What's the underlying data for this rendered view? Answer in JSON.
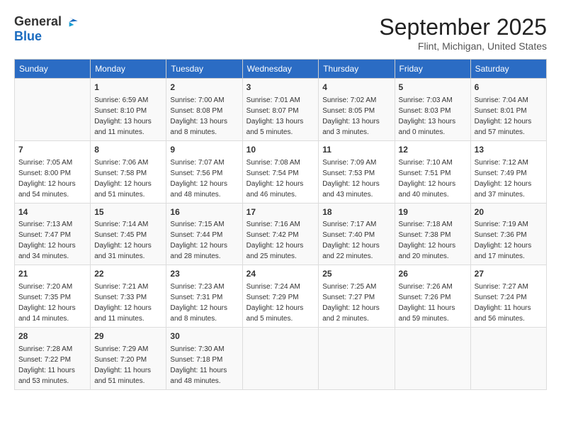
{
  "header": {
    "logo_general": "General",
    "logo_blue": "Blue",
    "month": "September 2025",
    "location": "Flint, Michigan, United States"
  },
  "days_of_week": [
    "Sunday",
    "Monday",
    "Tuesday",
    "Wednesday",
    "Thursday",
    "Friday",
    "Saturday"
  ],
  "weeks": [
    [
      {
        "day": "",
        "info": ""
      },
      {
        "day": "1",
        "info": "Sunrise: 6:59 AM\nSunset: 8:10 PM\nDaylight: 13 hours\nand 11 minutes."
      },
      {
        "day": "2",
        "info": "Sunrise: 7:00 AM\nSunset: 8:08 PM\nDaylight: 13 hours\nand 8 minutes."
      },
      {
        "day": "3",
        "info": "Sunrise: 7:01 AM\nSunset: 8:07 PM\nDaylight: 13 hours\nand 5 minutes."
      },
      {
        "day": "4",
        "info": "Sunrise: 7:02 AM\nSunset: 8:05 PM\nDaylight: 13 hours\nand 3 minutes."
      },
      {
        "day": "5",
        "info": "Sunrise: 7:03 AM\nSunset: 8:03 PM\nDaylight: 13 hours\nand 0 minutes."
      },
      {
        "day": "6",
        "info": "Sunrise: 7:04 AM\nSunset: 8:01 PM\nDaylight: 12 hours\nand 57 minutes."
      }
    ],
    [
      {
        "day": "7",
        "info": "Sunrise: 7:05 AM\nSunset: 8:00 PM\nDaylight: 12 hours\nand 54 minutes."
      },
      {
        "day": "8",
        "info": "Sunrise: 7:06 AM\nSunset: 7:58 PM\nDaylight: 12 hours\nand 51 minutes."
      },
      {
        "day": "9",
        "info": "Sunrise: 7:07 AM\nSunset: 7:56 PM\nDaylight: 12 hours\nand 48 minutes."
      },
      {
        "day": "10",
        "info": "Sunrise: 7:08 AM\nSunset: 7:54 PM\nDaylight: 12 hours\nand 46 minutes."
      },
      {
        "day": "11",
        "info": "Sunrise: 7:09 AM\nSunset: 7:53 PM\nDaylight: 12 hours\nand 43 minutes."
      },
      {
        "day": "12",
        "info": "Sunrise: 7:10 AM\nSunset: 7:51 PM\nDaylight: 12 hours\nand 40 minutes."
      },
      {
        "day": "13",
        "info": "Sunrise: 7:12 AM\nSunset: 7:49 PM\nDaylight: 12 hours\nand 37 minutes."
      }
    ],
    [
      {
        "day": "14",
        "info": "Sunrise: 7:13 AM\nSunset: 7:47 PM\nDaylight: 12 hours\nand 34 minutes."
      },
      {
        "day": "15",
        "info": "Sunrise: 7:14 AM\nSunset: 7:45 PM\nDaylight: 12 hours\nand 31 minutes."
      },
      {
        "day": "16",
        "info": "Sunrise: 7:15 AM\nSunset: 7:44 PM\nDaylight: 12 hours\nand 28 minutes."
      },
      {
        "day": "17",
        "info": "Sunrise: 7:16 AM\nSunset: 7:42 PM\nDaylight: 12 hours\nand 25 minutes."
      },
      {
        "day": "18",
        "info": "Sunrise: 7:17 AM\nSunset: 7:40 PM\nDaylight: 12 hours\nand 22 minutes."
      },
      {
        "day": "19",
        "info": "Sunrise: 7:18 AM\nSunset: 7:38 PM\nDaylight: 12 hours\nand 20 minutes."
      },
      {
        "day": "20",
        "info": "Sunrise: 7:19 AM\nSunset: 7:36 PM\nDaylight: 12 hours\nand 17 minutes."
      }
    ],
    [
      {
        "day": "21",
        "info": "Sunrise: 7:20 AM\nSunset: 7:35 PM\nDaylight: 12 hours\nand 14 minutes."
      },
      {
        "day": "22",
        "info": "Sunrise: 7:21 AM\nSunset: 7:33 PM\nDaylight: 12 hours\nand 11 minutes."
      },
      {
        "day": "23",
        "info": "Sunrise: 7:23 AM\nSunset: 7:31 PM\nDaylight: 12 hours\nand 8 minutes."
      },
      {
        "day": "24",
        "info": "Sunrise: 7:24 AM\nSunset: 7:29 PM\nDaylight: 12 hours\nand 5 minutes."
      },
      {
        "day": "25",
        "info": "Sunrise: 7:25 AM\nSunset: 7:27 PM\nDaylight: 12 hours\nand 2 minutes."
      },
      {
        "day": "26",
        "info": "Sunrise: 7:26 AM\nSunset: 7:26 PM\nDaylight: 11 hours\nand 59 minutes."
      },
      {
        "day": "27",
        "info": "Sunrise: 7:27 AM\nSunset: 7:24 PM\nDaylight: 11 hours\nand 56 minutes."
      }
    ],
    [
      {
        "day": "28",
        "info": "Sunrise: 7:28 AM\nSunset: 7:22 PM\nDaylight: 11 hours\nand 53 minutes."
      },
      {
        "day": "29",
        "info": "Sunrise: 7:29 AM\nSunset: 7:20 PM\nDaylight: 11 hours\nand 51 minutes."
      },
      {
        "day": "30",
        "info": "Sunrise: 7:30 AM\nSunset: 7:18 PM\nDaylight: 11 hours\nand 48 minutes."
      },
      {
        "day": "",
        "info": ""
      },
      {
        "day": "",
        "info": ""
      },
      {
        "day": "",
        "info": ""
      },
      {
        "day": "",
        "info": ""
      }
    ]
  ]
}
